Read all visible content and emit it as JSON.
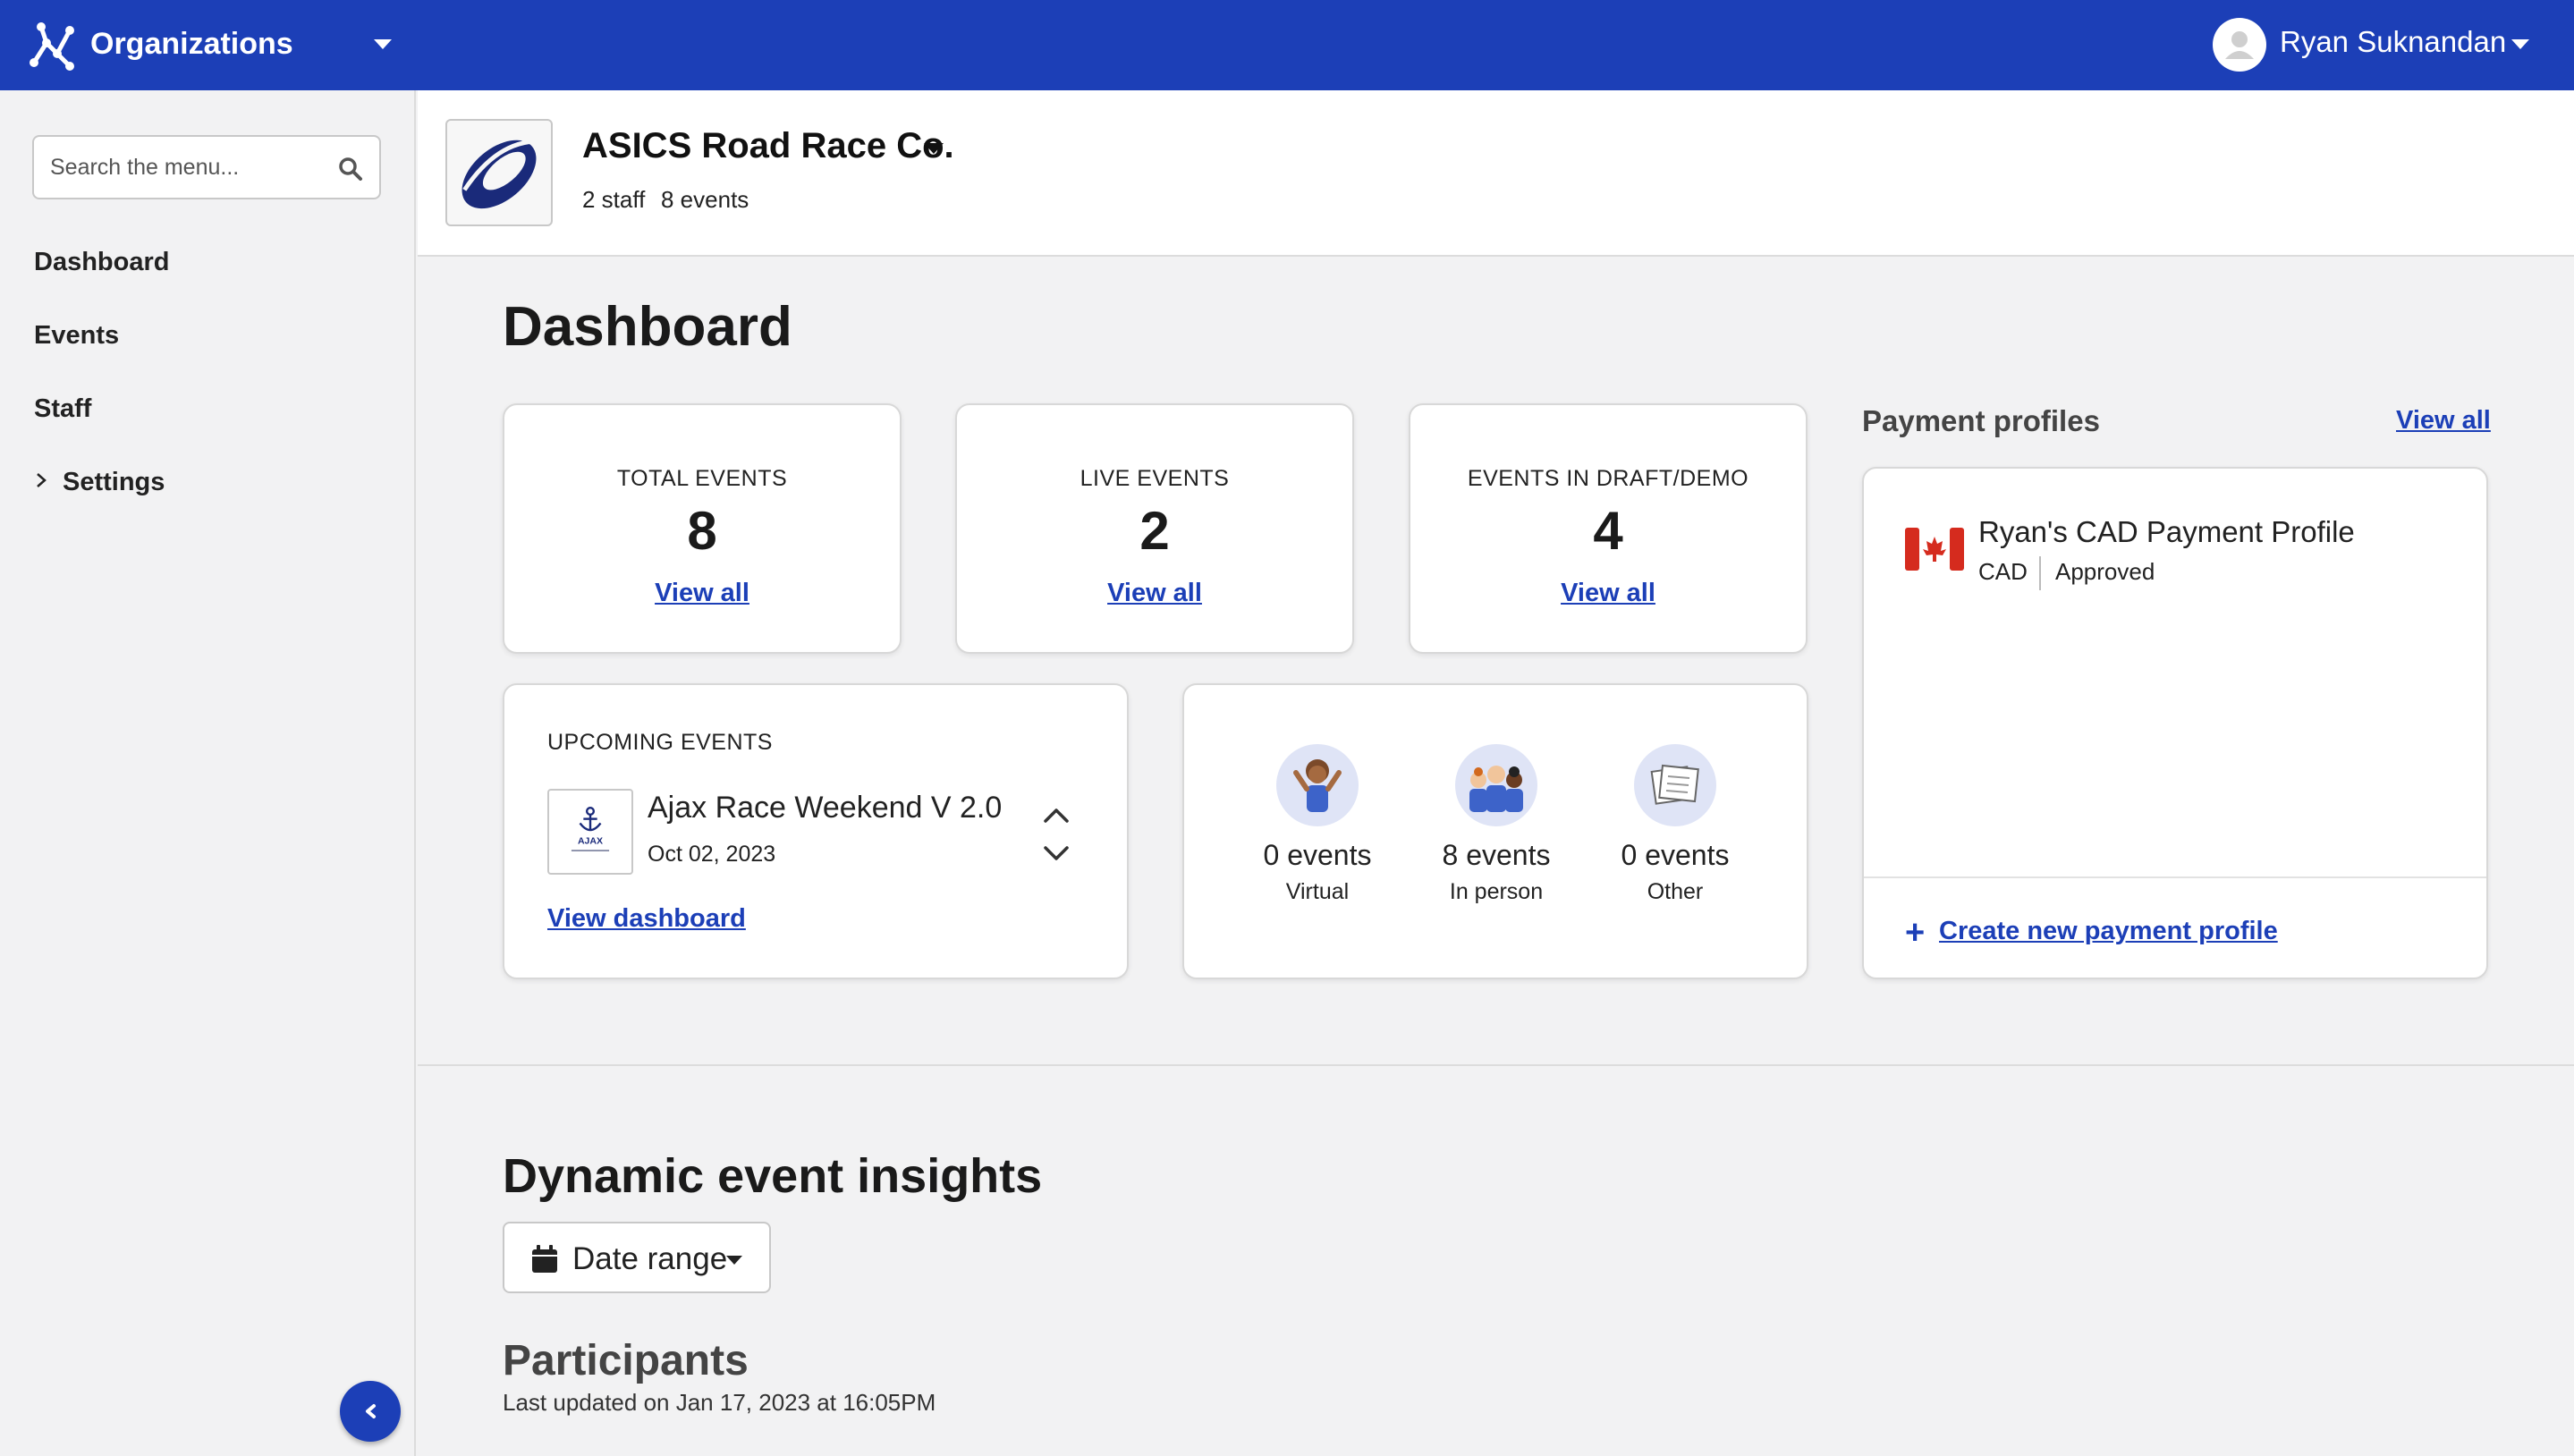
{
  "topbar": {
    "app_title": "Organizations",
    "user_name": "Ryan Suknandan",
    "colors": {
      "primary": "#1c3fb7"
    }
  },
  "sidebar": {
    "search_placeholder": "Search the menu...",
    "items": [
      {
        "label": "Dashboard"
      },
      {
        "label": "Events"
      },
      {
        "label": "Staff"
      },
      {
        "label": "Settings"
      }
    ]
  },
  "org": {
    "name": "ASICS Road Race Co.",
    "staff": "2 staff",
    "events": "8 events"
  },
  "dashboard": {
    "title": "Dashboard",
    "stats": [
      {
        "label": "TOTAL EVENTS",
        "value": "8",
        "link": "View all"
      },
      {
        "label": "LIVE EVENTS",
        "value": "2",
        "link": "View all"
      },
      {
        "label": "EVENTS IN DRAFT/DEMO",
        "value": "4",
        "link": "View all"
      }
    ],
    "upcoming": {
      "label": "UPCOMING EVENTS",
      "event_name": "Ajax Race Weekend V 2.0",
      "event_date": "Oct 02, 2023",
      "link": "View dashboard",
      "thumb_text": "AJAX"
    },
    "event_types": [
      {
        "count": "0 events",
        "label": "Virtual",
        "icon": "virtual-person-icon"
      },
      {
        "count": "8 events",
        "label": "In person",
        "icon": "group-people-icon"
      },
      {
        "count": "0 events",
        "label": "Other",
        "icon": "documents-icon"
      }
    ]
  },
  "payment_profiles": {
    "title": "Payment profiles",
    "view_all": "View all",
    "profile": {
      "name": "Ryan's CAD Payment Profile",
      "currency": "CAD",
      "status": "Approved",
      "flag_icon": "canada-flag-icon"
    },
    "create_label": "Create new payment profile"
  },
  "insights": {
    "title": "Dynamic event insights",
    "date_range_label": "Date range",
    "participants_title": "Participants",
    "last_updated": "Last updated on Jan 17, 2023 at 16:05PM"
  }
}
